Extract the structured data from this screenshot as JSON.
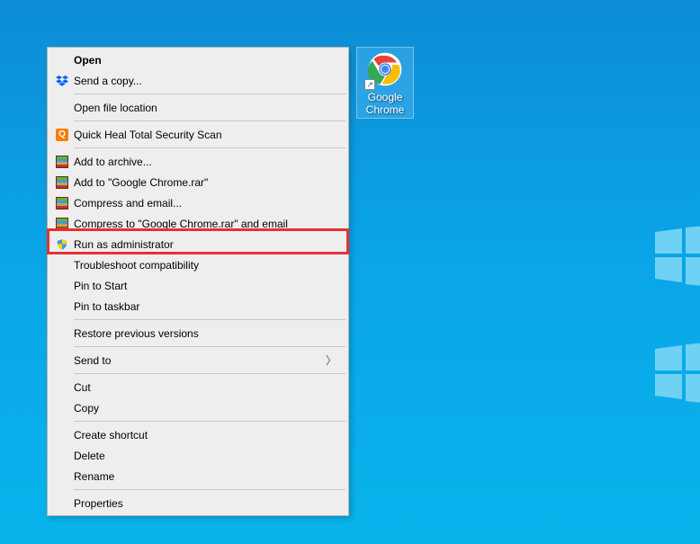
{
  "desktop": {
    "icon_label": "Google Chrome"
  },
  "context_menu": {
    "open": "Open",
    "send_copy": "Send a copy...",
    "open_file_location": "Open file location",
    "quick_heal": "Quick Heal Total Security Scan",
    "add_to_archive": "Add to archive...",
    "add_to_rar": "Add to \"Google Chrome.rar\"",
    "compress_email": "Compress and email...",
    "compress_to_rar_email": "Compress to \"Google Chrome.rar\" and email",
    "run_as_admin": "Run as administrator",
    "troubleshoot": "Troubleshoot compatibility",
    "pin_start": "Pin to Start",
    "pin_taskbar": "Pin to taskbar",
    "restore_prev": "Restore previous versions",
    "send_to": "Send to",
    "cut": "Cut",
    "copy": "Copy",
    "create_shortcut": "Create shortcut",
    "delete": "Delete",
    "rename": "Rename",
    "properties": "Properties"
  }
}
